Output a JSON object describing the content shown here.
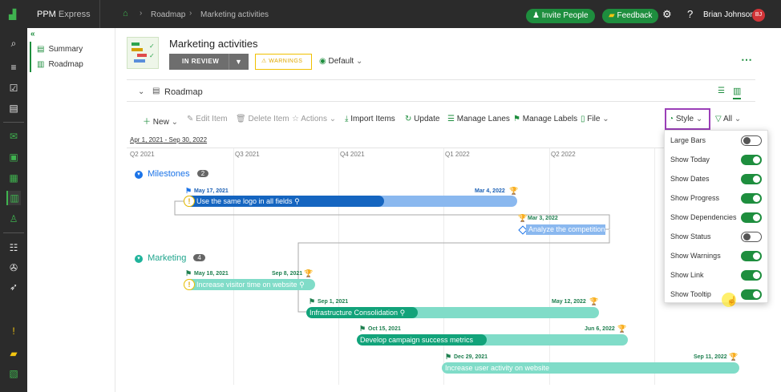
{
  "header": {
    "app_name": "PPM",
    "app_name2": "Express",
    "breadcrumb": [
      "Roadmap",
      "Marketing activities"
    ],
    "invite_label": "Invite People",
    "feedback_label": "Feedback",
    "user_name": "Brian Johnson",
    "user_initials": "BJ"
  },
  "subnav": {
    "items": [
      {
        "label": "Summary"
      },
      {
        "label": "Roadmap"
      }
    ]
  },
  "project": {
    "title": "Marketing activities",
    "status": "IN REVIEW",
    "warnings_label": "WARNINGS",
    "view_label": "Default"
  },
  "section": {
    "title": "Roadmap"
  },
  "toolbar": {
    "new": "New",
    "edit": "Edit Item",
    "delete": "Delete Item",
    "actions": "Actions",
    "import": "Import Items",
    "update": "Update",
    "manage_lanes": "Manage Lanes",
    "manage_labels": "Manage Labels",
    "file": "File",
    "style": "Style",
    "filter": "All"
  },
  "date_range": {
    "start": "Apr 1, 2021",
    "sep": " - ",
    "end": "Sep 30, 2022"
  },
  "quarters": [
    "Q2 2021",
    "Q3 2021",
    "Q4 2021",
    "Q1 2022",
    "Q2 2022"
  ],
  "lanes": [
    {
      "name": "Milestones",
      "count": "2"
    },
    {
      "name": "Marketing",
      "count": "4"
    }
  ],
  "items": [
    {
      "title": "Use the same logo in all fields",
      "start": "May 17, 2021",
      "end": "Mar 4, 2022",
      "progress": 0.6
    },
    {
      "title": "Analyze the competition",
      "date": "Mar 3, 2022"
    },
    {
      "title": "Increase visitor time on website",
      "start": "May 18, 2021",
      "end": "Sep 8, 2021"
    },
    {
      "title": "Infrastructure Consolidation",
      "start": "Sep 1, 2021",
      "end": "May 12, 2022"
    },
    {
      "title": "Develop campaign success metrics",
      "start": "Oct 15, 2021",
      "end": "Jun 6, 2022"
    },
    {
      "title": "Increase user activity on website",
      "start": "Dec 29, 2021",
      "end": "Sep 11, 2022"
    }
  ],
  "style_menu": [
    {
      "label": "Large Bars",
      "on": false
    },
    {
      "label": "Show Today",
      "on": true
    },
    {
      "label": "Show Dates",
      "on": true
    },
    {
      "label": "Show Progress",
      "on": true
    },
    {
      "label": "Show Dependencies",
      "on": true
    },
    {
      "label": "Show Status",
      "on": false
    },
    {
      "label": "Show Warnings",
      "on": true
    },
    {
      "label": "Show Link",
      "on": true
    },
    {
      "label": "Show Tooltip",
      "on": true
    }
  ],
  "colors": {
    "green": "#1e8e3e",
    "blue": "#1a73e8",
    "teal": "#1fb39b",
    "teal_light": "#80dcc8",
    "blue_light": "#8ab8ef"
  }
}
